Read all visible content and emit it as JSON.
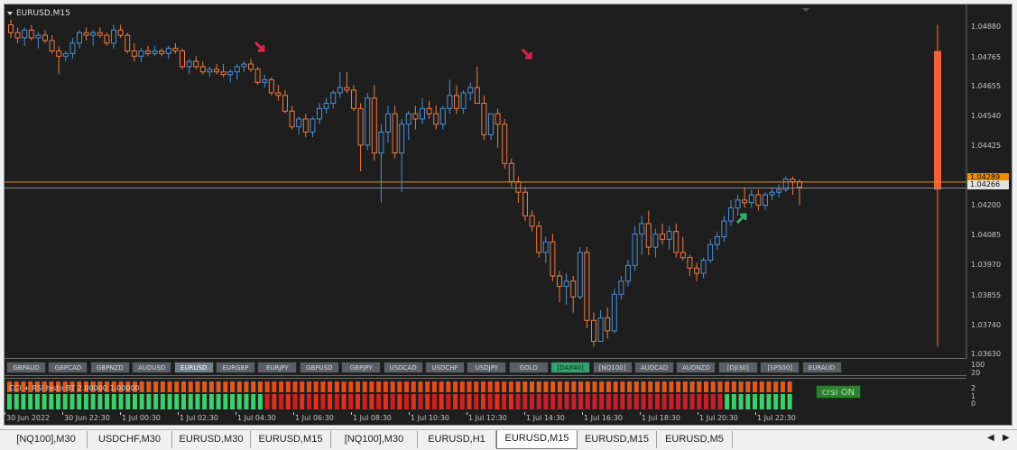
{
  "window": {
    "title": "EURUSD,M15"
  },
  "price_axis": {
    "labels": [
      "1.04880",
      "1.04765",
      "1.04655",
      "1.04540",
      "1.04425",
      "1.04310",
      "1.04200",
      "1.04085",
      "1.03970",
      "1.03855",
      "1.03740",
      "1.03630"
    ],
    "current_bid": "1.04266",
    "current_ask": "1.04289"
  },
  "colors": {
    "bull": "#4a90d9",
    "bear": "#f07a40",
    "price_line": "#f08c00",
    "arrow_down": "#e0224a",
    "arrow_up": "#2fb36b"
  },
  "symbol_buttons": [
    {
      "label": "GBPAUD",
      "state": "normal"
    },
    {
      "label": "GBPCAD",
      "state": "normal"
    },
    {
      "label": "GBPNZD",
      "state": "normal"
    },
    {
      "label": "AUDUSD",
      "state": "normal"
    },
    {
      "label": "EURUSD",
      "state": "active"
    },
    {
      "label": "EURGBP",
      "state": "normal"
    },
    {
      "label": "EURJPY",
      "state": "normal"
    },
    {
      "label": "GBPUSD",
      "state": "normal"
    },
    {
      "label": "GBPJPY",
      "state": "normal"
    },
    {
      "label": "USDCAD",
      "state": "normal"
    },
    {
      "label": "USDCHF",
      "state": "normal"
    },
    {
      "label": "USDJPY",
      "state": "normal"
    },
    {
      "label": "GOLD",
      "state": "normal"
    },
    {
      "label": "[DAX40]",
      "state": "green"
    },
    {
      "label": "[NQ100]",
      "state": "normal"
    },
    {
      "label": "AUDCAD",
      "state": "normal"
    },
    {
      "label": "AUDNZD",
      "state": "normal"
    },
    {
      "label": "[DJI30]",
      "state": "normal"
    },
    {
      "label": "[SP500]",
      "state": "normal"
    },
    {
      "label": "EURAUD",
      "state": "normal"
    }
  ],
  "indicator": {
    "label": "CCI + RSI histo BT 2.00000 1.00000",
    "badge": "crsi ON",
    "axis_labels": [
      "100",
      "20",
      "2",
      "1",
      "0"
    ]
  },
  "time_axis": [
    "30 Jun 2022",
    "30 Jun 22:30",
    "1 Jul 00:30",
    "1 Jul 02:30",
    "1 Jul 04:30",
    "1 Jul 06:30",
    "1 Jul 08:30",
    "1 Jul 10:30",
    "1 Jul 12:30",
    "1 Jul 14:30",
    "1 Jul 16:30",
    "1 Jul 18:30",
    "1 Jul 20:30",
    "1 Jul 22:30"
  ],
  "tabs": [
    {
      "label": "[NQ100],M30",
      "active": false
    },
    {
      "label": "USDCHF,M30",
      "active": false
    },
    {
      "label": "EURUSD,M30",
      "active": false
    },
    {
      "label": "EURUSD,M15",
      "active": false
    },
    {
      "label": "[NQ100],M30",
      "active": false
    },
    {
      "label": "EURUSD,H1",
      "active": false
    },
    {
      "label": "EURUSD,M15",
      "active": true
    },
    {
      "label": "EURUSD,M15",
      "active": false
    },
    {
      "label": "EURUSD,M5",
      "active": false
    }
  ],
  "chart_data": {
    "type": "candlestick",
    "symbol": "EURUSD",
    "timeframe": "M15",
    "ylim": [
      1.0363,
      1.0494
    ],
    "candles": [
      [
        1.0489,
        1.0491,
        1.0484,
        1.0486
      ],
      [
        1.0486,
        1.0488,
        1.0482,
        1.0484
      ],
      [
        1.0484,
        1.0488,
        1.0481,
        1.0487
      ],
      [
        1.0487,
        1.0489,
        1.0483,
        1.0484
      ],
      [
        1.0484,
        1.0486,
        1.048,
        1.0485
      ],
      [
        1.0485,
        1.0487,
        1.0482,
        1.0483
      ],
      [
        1.0483,
        1.0485,
        1.0478,
        1.0479
      ],
      [
        1.0479,
        1.0481,
        1.047,
        1.0477
      ],
      [
        1.0477,
        1.0479,
        1.0475,
        1.0478
      ],
      [
        1.0478,
        1.0484,
        1.0476,
        1.0482
      ],
      [
        1.0482,
        1.0487,
        1.048,
        1.0486
      ],
      [
        1.0486,
        1.0488,
        1.0483,
        1.0485
      ],
      [
        1.0485,
        1.0487,
        1.0481,
        1.0486
      ],
      [
        1.0486,
        1.0488,
        1.0484,
        1.0485
      ],
      [
        1.0485,
        1.0486,
        1.0481,
        1.0482
      ],
      [
        1.0482,
        1.0489,
        1.048,
        1.0487
      ],
      [
        1.0487,
        1.0489,
        1.0484,
        1.0485
      ],
      [
        1.0485,
        1.0486,
        1.0478,
        1.0479
      ],
      [
        1.0479,
        1.0482,
        1.0475,
        1.0477
      ],
      [
        1.0477,
        1.048,
        1.0475,
        1.0479
      ],
      [
        1.0479,
        1.0481,
        1.0477,
        1.0478
      ],
      [
        1.0478,
        1.0481,
        1.0477,
        1.0479
      ],
      [
        1.0479,
        1.048,
        1.0477,
        1.0478
      ],
      [
        1.0478,
        1.0481,
        1.0476,
        1.048
      ],
      [
        1.048,
        1.0482,
        1.0478,
        1.0479
      ],
      [
        1.0479,
        1.048,
        1.0472,
        1.0473
      ],
      [
        1.0473,
        1.0476,
        1.047,
        1.0475
      ],
      [
        1.0475,
        1.0477,
        1.0472,
        1.0473
      ],
      [
        1.0473,
        1.0475,
        1.047,
        1.0471
      ],
      [
        1.0471,
        1.0473,
        1.0469,
        1.0472
      ],
      [
        1.0472,
        1.0474,
        1.047,
        1.0471
      ],
      [
        1.0471,
        1.0474,
        1.0469,
        1.047
      ],
      [
        1.047,
        1.0472,
        1.0467,
        1.0471
      ],
      [
        1.0471,
        1.0474,
        1.0468,
        1.0473
      ],
      [
        1.0473,
        1.0475,
        1.0471,
        1.0474
      ],
      [
        1.0474,
        1.0476,
        1.0471,
        1.0472
      ],
      [
        1.0472,
        1.0473,
        1.0466,
        1.0467
      ],
      [
        1.0467,
        1.047,
        1.0465,
        1.0468
      ],
      [
        1.0468,
        1.0469,
        1.0462,
        1.0463
      ],
      [
        1.0463,
        1.0466,
        1.046,
        1.0462
      ],
      [
        1.0462,
        1.0464,
        1.0455,
        1.0456
      ],
      [
        1.0456,
        1.0458,
        1.0449,
        1.045
      ],
      [
        1.045,
        1.0454,
        1.0447,
        1.0453
      ],
      [
        1.0453,
        1.0455,
        1.0446,
        1.0448
      ],
      [
        1.0448,
        1.0454,
        1.0446,
        1.0453
      ],
      [
        1.0453,
        1.0459,
        1.0451,
        1.0457
      ],
      [
        1.0457,
        1.0461,
        1.0455,
        1.0459
      ],
      [
        1.0459,
        1.0464,
        1.0457,
        1.0463
      ],
      [
        1.0463,
        1.0471,
        1.0461,
        1.0465
      ],
      [
        1.0465,
        1.0471,
        1.0463,
        1.0464
      ],
      [
        1.0464,
        1.0466,
        1.0456,
        1.0457
      ],
      [
        1.0457,
        1.0459,
        1.0433,
        1.0443
      ],
      [
        1.0443,
        1.0463,
        1.0441,
        1.0461
      ],
      [
        1.0461,
        1.0466,
        1.0437,
        1.044
      ],
      [
        1.044,
        1.0451,
        1.0421,
        1.0448
      ],
      [
        1.0448,
        1.0458,
        1.0444,
        1.0455
      ],
      [
        1.0455,
        1.0458,
        1.0438,
        1.044
      ],
      [
        1.044,
        1.0453,
        1.0425,
        1.0451
      ],
      [
        1.0451,
        1.0456,
        1.0445,
        1.0455
      ],
      [
        1.0455,
        1.0458,
        1.0449,
        1.0453
      ],
      [
        1.0453,
        1.0461,
        1.0451,
        1.0457
      ],
      [
        1.0457,
        1.046,
        1.0453,
        1.0455
      ],
      [
        1.0455,
        1.0458,
        1.0449,
        1.0451
      ],
      [
        1.0451,
        1.0458,
        1.0449,
        1.0457
      ],
      [
        1.0457,
        1.0468,
        1.0455,
        1.0462
      ],
      [
        1.0462,
        1.0466,
        1.0455,
        1.0457
      ],
      [
        1.0457,
        1.0464,
        1.0455,
        1.0463
      ],
      [
        1.0463,
        1.0467,
        1.046,
        1.0465
      ],
      [
        1.0465,
        1.0473,
        1.0462,
        1.0459
      ],
      [
        1.0459,
        1.0462,
        1.0445,
        1.0447
      ],
      [
        1.0447,
        1.0451,
        1.0445,
        1.0455
      ],
      [
        1.0455,
        1.0457,
        1.0442,
        1.0451
      ],
      [
        1.0451,
        1.0453,
        1.0434,
        1.0436
      ],
      [
        1.0436,
        1.0438,
        1.0427,
        1.0429
      ],
      [
        1.0429,
        1.0431,
        1.0421,
        1.0425
      ],
      [
        1.0425,
        1.0427,
        1.0414,
        1.0416
      ],
      [
        1.0416,
        1.0418,
        1.041,
        1.0412
      ],
      [
        1.0412,
        1.0414,
        1.04,
        1.0402
      ],
      [
        1.0402,
        1.0408,
        1.0398,
        1.0406
      ],
      [
        1.0406,
        1.0409,
        1.0391,
        1.0393
      ],
      [
        1.0393,
        1.0395,
        1.0383,
        1.0389
      ],
      [
        1.0389,
        1.0394,
        1.0382,
        1.0391
      ],
      [
        1.0391,
        1.0393,
        1.0379,
        1.0385
      ],
      [
        1.0385,
        1.0404,
        1.0384,
        1.0402
      ],
      [
        1.0402,
        1.0404,
        1.0373,
        1.0376
      ],
      [
        1.0376,
        1.0379,
        1.0366,
        1.0368
      ],
      [
        1.0368,
        1.038,
        1.037,
        1.0377
      ],
      [
        1.0377,
        1.0381,
        1.0369,
        1.0372
      ],
      [
        1.0372,
        1.0388,
        1.0371,
        1.0386
      ],
      [
        1.0386,
        1.0393,
        1.0384,
        1.0391
      ],
      [
        1.0391,
        1.0399,
        1.0389,
        1.0397
      ],
      [
        1.0397,
        1.0412,
        1.0395,
        1.0409
      ],
      [
        1.0409,
        1.0416,
        1.0401,
        1.0413
      ],
      [
        1.0413,
        1.0418,
        1.0401,
        1.0404
      ],
      [
        1.0404,
        1.0411,
        1.04,
        1.0409
      ],
      [
        1.0409,
        1.0413,
        1.0405,
        1.0407
      ],
      [
        1.0407,
        1.0412,
        1.0403,
        1.041
      ],
      [
        1.041,
        1.0413,
        1.04,
        1.0402
      ],
      [
        1.0402,
        1.0408,
        1.0399,
        1.04
      ],
      [
        1.04,
        1.0401,
        1.0393,
        1.0396
      ],
      [
        1.0396,
        1.0398,
        1.0391,
        1.0394
      ],
      [
        1.0394,
        1.04,
        1.0392,
        1.0399
      ],
      [
        1.0399,
        1.0407,
        1.0398,
        1.0405
      ],
      [
        1.0405,
        1.041,
        1.0403,
        1.0408
      ],
      [
        1.0408,
        1.0416,
        1.0406,
        1.0414
      ],
      [
        1.0414,
        1.0422,
        1.0412,
        1.0419
      ],
      [
        1.0419,
        1.0424,
        1.0416,
        1.0422
      ],
      [
        1.0422,
        1.0427,
        1.0419,
        1.0421
      ],
      [
        1.0421,
        1.0426,
        1.0419,
        1.0424
      ],
      [
        1.0424,
        1.0426,
        1.0418,
        1.042
      ],
      [
        1.042,
        1.0425,
        1.0418,
        1.0424
      ],
      [
        1.0424,
        1.0427,
        1.0422,
        1.0425
      ],
      [
        1.0425,
        1.0428,
        1.0423,
        1.0426
      ],
      [
        1.0426,
        1.0431,
        1.0425,
        1.043
      ],
      [
        1.043,
        1.0431,
        1.0424,
        1.0429
      ],
      [
        1.0429,
        1.043,
        1.042,
        1.0427
      ]
    ],
    "current_bar": {
      "open": 1.0426,
      "high": 1.0489,
      "low": 1.0366,
      "close": 1.0479
    },
    "current_price": 1.04266,
    "signals": [
      {
        "type": "sell",
        "bar": 22
      },
      {
        "type": "sell",
        "bar": 70
      },
      {
        "type": "buy",
        "bar": 102
      }
    ]
  }
}
